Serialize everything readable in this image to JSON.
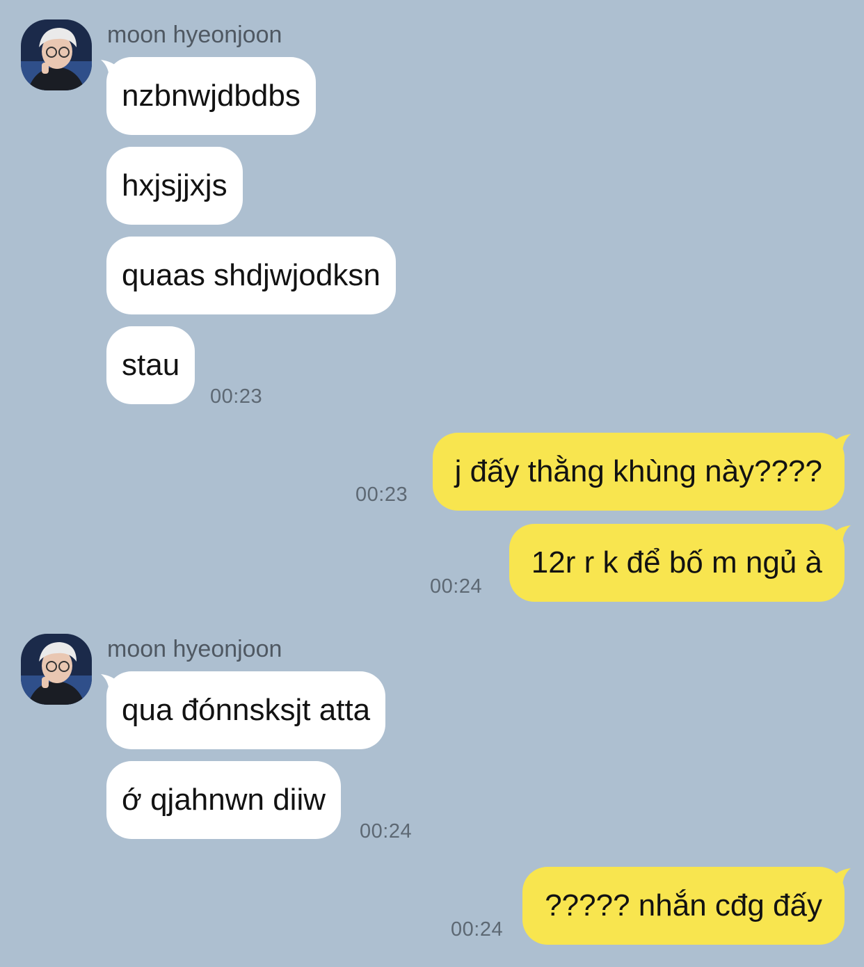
{
  "colors": {
    "background": "#adbfd0",
    "incoming_bubble": "#ffffff",
    "outgoing_bubble": "#f8e54f",
    "timestamp": "#5d6873",
    "sender_name": "#4f5862"
  },
  "messages": {
    "group1": {
      "sender": "moon hyeonjoon",
      "avatar_icon": "profile-photo",
      "bubbles": [
        "nzbnwjdbdbs",
        "hxjsjjxjs",
        "quaas shdjwjodksn",
        "stau"
      ],
      "time": "00:23"
    },
    "out1": {
      "text": "j đấy thằng khùng này????",
      "time": "00:23"
    },
    "out2": {
      "text": "12r r k để bố m ngủ à",
      "time": "00:24"
    },
    "group2": {
      "sender": "moon hyeonjoon",
      "avatar_icon": "profile-photo",
      "bubbles": [
        "qua đónnsksjt atta",
        "ớ qjahnwn diiw"
      ],
      "time": "00:24"
    },
    "out3": {
      "text": "????? nhắn cđg đấy",
      "time": "00:24"
    }
  }
}
